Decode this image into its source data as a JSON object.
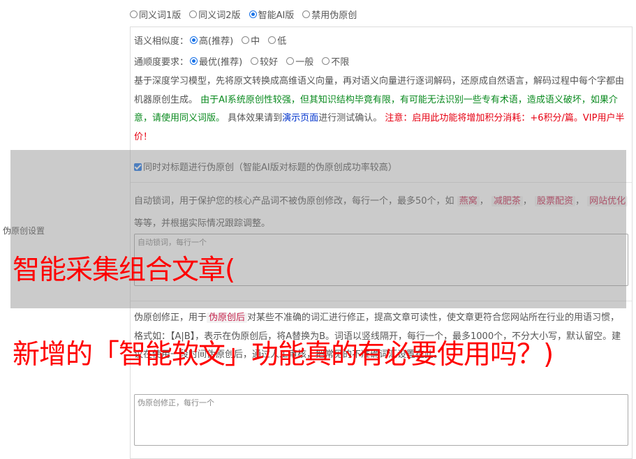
{
  "version_options": [
    {
      "label": "同义词1版",
      "checked": false
    },
    {
      "label": "同义词2版",
      "checked": false
    },
    {
      "label": "智能AI版",
      "checked": true
    },
    {
      "label": "禁用伪原创",
      "checked": false
    }
  ],
  "section_label": "伪原创设置",
  "similarity": {
    "label": "语义相似度：",
    "options": [
      {
        "label": "高(推荐)",
        "checked": true
      },
      {
        "label": "中",
        "checked": false
      },
      {
        "label": "低",
        "checked": false
      }
    ]
  },
  "fluency": {
    "label": "通顺度要求：",
    "options": [
      {
        "label": "最优(推荐)",
        "checked": true
      },
      {
        "label": "较好",
        "checked": false
      },
      {
        "label": "一般",
        "checked": false
      },
      {
        "label": "不限",
        "checked": false
      }
    ]
  },
  "ai_desc": {
    "part1": "基于深度学习模型，先将原文转换成高维语义向量，再对语义向量进行逐词解码，还原成自然语言，解码过程中每个字都由机器原创生成。",
    "part2_green": "由于AI系统原创性较强，但其知识结构毕竟有限，有可能无法识别一些专有术语，造成语义破坏，如果介意，请使用同义词版。",
    "part3": "具体效果请到",
    "link": "演示页面",
    "part4": "进行测试确认。",
    "part5_red": "注意：启用此功能将增加积分消耗：+6积分/篇。VIP用户半价！"
  },
  "title_checkbox": {
    "label": "同时对标题进行伪原创（智能AI版对标题的伪原创成功率较高）",
    "checked": true
  },
  "lock_desc": {
    "prefix": "自动锁词，用于保护您的核心产品词不被伪原创修改，每行一个，最多50个，如",
    "tags": [
      "燕窝",
      "减肥茶",
      "股票配资",
      "网站优化"
    ],
    "suffix": "等等，并根据实际情况跟踪调整。"
  },
  "lock_textarea": {
    "placeholder": "自动锁词，每行一个"
  },
  "fix_desc": {
    "prefix": "伪原创修正，用于",
    "tag": "伪原创后",
    "rest": "对某些不准确的词汇进行修正，提高文章可读性，使文章更符合您网站所在行业的用语习惯，格式如：【A|B】，表示在伪原创后，将A替换为B。词语以竖线隔开，每行一个，最多1000个，不分大小写，默认留空。建议在使用一段时间伪原创后，通过人工审核，把常见的不准确词汇设置在此。"
  },
  "fix_textarea": {
    "placeholder": "伪原创修正，每行一个"
  },
  "overlay_headline_1": "智能采集组合文章(",
  "overlay_headline_2": "新增的「智能软文」功能真的有必要使用吗？)"
}
